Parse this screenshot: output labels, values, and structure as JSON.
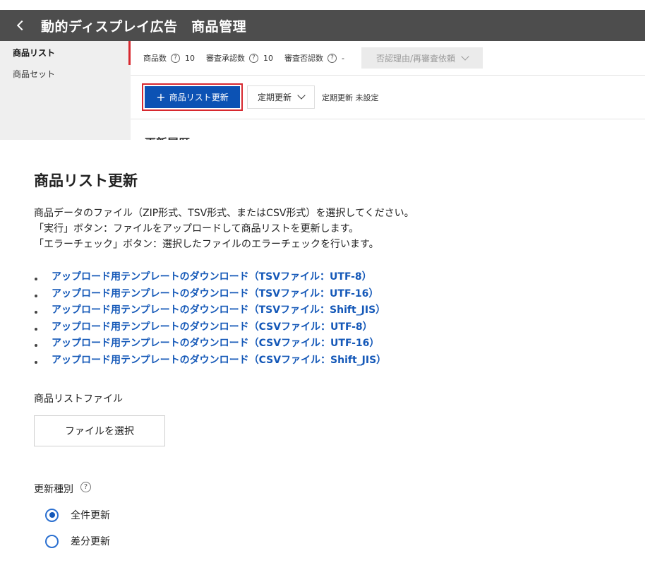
{
  "header": {
    "title": "動的ディスプレイ広告　商品管理"
  },
  "sidebar": {
    "items": [
      {
        "label": "商品リスト"
      },
      {
        "label": "商品セット"
      }
    ]
  },
  "stats": {
    "product_count_label": "商品数",
    "product_count_value": "10",
    "approved_label": "審査承認数",
    "approved_value": "10",
    "rejected_label": "審査否認数",
    "rejected_value": "-",
    "reason_dropdown": "否認理由/再審査依頼"
  },
  "toolbar": {
    "update_button": "商品リスト更新",
    "periodic_dropdown": "定期更新",
    "periodic_status": "定期更新 未設定"
  },
  "cut_heading": "更新履歴",
  "dialog": {
    "title": "商品リスト更新",
    "desc": [
      "商品データのファイル（ZIP形式、TSV形式、またはCSV形式）を選択してください。",
      "「実行」ボタン：ファイルをアップロードして商品リストを更新します。",
      "「エラーチェック」ボタン：選択したファイルのエラーチェックを行います。"
    ],
    "links": [
      "アップロード用テンプレートのダウンロード（TSVファイル：UTF-8）",
      "アップロード用テンプレートのダウンロード（TSVファイル：UTF-16）",
      "アップロード用テンプレートのダウンロード（TSVファイル：Shift_JIS）",
      "アップロード用テンプレートのダウンロード（CSVファイル：UTF-8）",
      "アップロード用テンプレートのダウンロード（CSVファイル：UTF-16）",
      "アップロード用テンプレートのダウンロード（CSVファイル：Shift_JIS）"
    ],
    "file_label": "商品リストファイル",
    "file_button": "ファイルを選択",
    "type_label": "更新種別",
    "options": [
      "全件更新",
      "差分更新"
    ],
    "selected_option": "全件更新"
  },
  "icons": {
    "back": "chevron-left-icon",
    "help": "question-circle-icon",
    "dropdown": "chevron-down-icon",
    "plus": "plus-icon"
  },
  "colors": {
    "header_bg": "#4d4d4d",
    "primary_button": "#0c52b4",
    "highlight_border": "#d7282f",
    "link": "#1458b8"
  }
}
